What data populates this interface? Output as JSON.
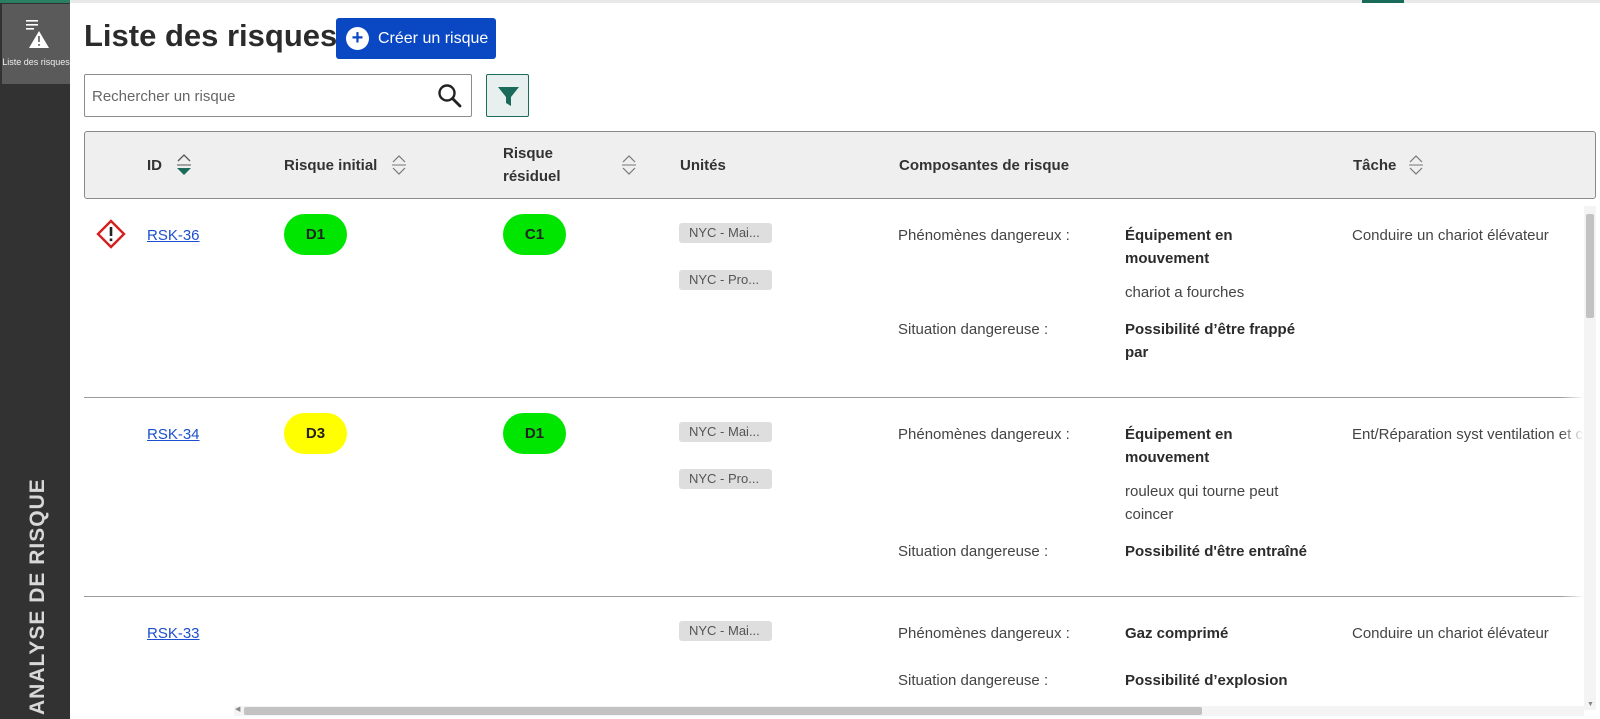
{
  "sidebar": {
    "nav_item_label": "Liste des risques",
    "vertical_title": "ANALYSE DE RISQUE"
  },
  "header": {
    "title": "Liste des risques",
    "create_button_label": "Créer un risque"
  },
  "search": {
    "placeholder": "Rechercher un risque",
    "value": ""
  },
  "table": {
    "columns": {
      "id": "ID",
      "initial_risk": "Risque initial",
      "residual_risk": "Risque résiduel",
      "units": "Unités",
      "risk_components": "Composantes de risque",
      "task": "Tâche"
    },
    "component_labels": {
      "hazard": "Phénomènes dangereux :",
      "situation": "Situation dangereuse :"
    },
    "rows": [
      {
        "id": "RSK-36",
        "has_warning": true,
        "initial_risk": "D1",
        "initial_color": "green",
        "residual_risk": "C1",
        "residual_color": "green",
        "units": [
          "NYC - Mai...",
          "NYC - Pro..."
        ],
        "hazard": "Équipement en mouvement",
        "hazard_detail": "chariot a fourches",
        "situation": "Possibilité d’être frappé par",
        "task": "Conduire un chariot élévateur"
      },
      {
        "id": "RSK-34",
        "has_warning": false,
        "initial_risk": "D3",
        "initial_color": "yellow",
        "residual_risk": "D1",
        "residual_color": "green",
        "units": [
          "NYC - Mai...",
          "NYC - Pro..."
        ],
        "hazard": "Équipement en mouvement",
        "hazard_detail": "rouleux qui tourne peut coincer",
        "situation": "Possibilité d'être entraîné",
        "task": "Ent/Réparation syst ventilation et c"
      },
      {
        "id": "RSK-33",
        "has_warning": false,
        "initial_risk": "",
        "residual_risk": "",
        "units": [
          "NYC - Mai..."
        ],
        "hazard": "Gaz comprimé",
        "hazard_detail": "",
        "situation": "Possibilité d’explosion",
        "task": "Conduire un chariot élévateur"
      }
    ]
  },
  "colors": {
    "sidebar_bg": "#323232",
    "primary_button": "#0a47c2",
    "accent_green": "#1b6b5a",
    "risk_green": "#00e600",
    "risk_yellow": "#ffff00",
    "link_blue": "#1c4fd0"
  }
}
